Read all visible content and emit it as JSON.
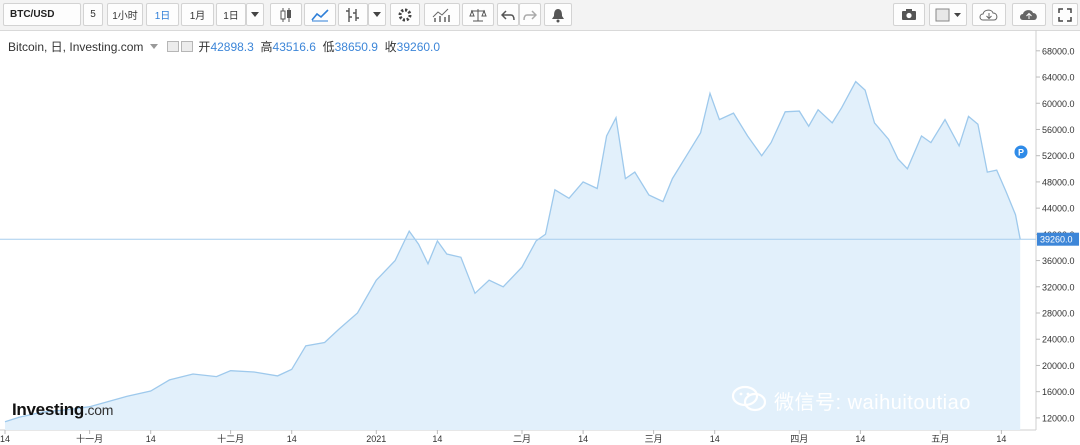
{
  "toolbar": {
    "symbol": "BTC/USD",
    "interval": "5",
    "intervals": [
      "1小时",
      "1日",
      "1月",
      "1日"
    ],
    "active_interval": "1日"
  },
  "legend": {
    "title": "Bitcoin, 日, Investing.com",
    "open_label": "开",
    "open": "42898.3",
    "high_label": "高",
    "high": "43516.6",
    "low_label": "低",
    "low": "38650.9",
    "close_label": "收",
    "close": "39260.0"
  },
  "brand": {
    "logo_main": "Investing",
    "logo_suffix": ".com"
  },
  "watermark": "微信号: waihuitoutiao",
  "marker": "P",
  "colors": {
    "line": "#9ec9ec",
    "fill": "#e2f0fb",
    "accent": "#2f7fd8",
    "price_label": "#3d86d8"
  },
  "chart_data": {
    "type": "area",
    "title": "Bitcoin, 日, Investing.com",
    "ylim": [
      10000,
      70000
    ],
    "yticks": [
      "68000.0",
      "64000.0",
      "60000.0",
      "56000.0",
      "52000.0",
      "48000.0",
      "44000.0",
      "40000.0",
      "36000.0",
      "32000.0",
      "28000.0",
      "24000.0",
      "20000.0",
      "16000.0",
      "12000.0"
    ],
    "last_price": "39260.0",
    "xticks": [
      {
        "label": "14",
        "day": 0
      },
      {
        "label": "十一月",
        "day": 18
      },
      {
        "label": "14",
        "day": 31
      },
      {
        "label": "十二月",
        "day": 48
      },
      {
        "label": "14",
        "day": 61
      },
      {
        "label": "2021",
        "day": 79
      },
      {
        "label": "14",
        "day": 92
      },
      {
        "label": "二月",
        "day": 110
      },
      {
        "label": "14",
        "day": 123
      },
      {
        "label": "三月",
        "day": 138
      },
      {
        "label": "14",
        "day": 151
      },
      {
        "label": "四月",
        "day": 169
      },
      {
        "label": "14",
        "day": 182
      },
      {
        "label": "五月",
        "day": 199
      },
      {
        "label": "14",
        "day": 212
      }
    ],
    "series": [
      {
        "points": [
          [
            0,
            11400
          ],
          [
            3,
            12100
          ],
          [
            8,
            12900
          ],
          [
            14,
            13300
          ],
          [
            18,
            13700
          ],
          [
            22,
            14500
          ],
          [
            26,
            15300
          ],
          [
            31,
            16100
          ],
          [
            35,
            17800
          ],
          [
            40,
            18700
          ],
          [
            45,
            18300
          ],
          [
            48,
            19200
          ],
          [
            53,
            19000
          ],
          [
            58,
            18400
          ],
          [
            61,
            19400
          ],
          [
            64,
            23000
          ],
          [
            68,
            23500
          ],
          [
            71,
            25500
          ],
          [
            75,
            28000
          ],
          [
            79,
            33000
          ],
          [
            83,
            36000
          ],
          [
            86,
            40500
          ],
          [
            88,
            38500
          ],
          [
            90,
            35500
          ],
          [
            92,
            39000
          ],
          [
            94,
            37000
          ],
          [
            97,
            36500
          ],
          [
            100,
            31000
          ],
          [
            103,
            33000
          ],
          [
            106,
            32000
          ],
          [
            110,
            35000
          ],
          [
            113,
            39000
          ],
          [
            115,
            40000
          ],
          [
            117,
            46800
          ],
          [
            120,
            45500
          ],
          [
            123,
            48000
          ],
          [
            126,
            47000
          ],
          [
            128,
            55000
          ],
          [
            130,
            57800
          ],
          [
            132,
            48500
          ],
          [
            134,
            49500
          ],
          [
            137,
            46000
          ],
          [
            140,
            45000
          ],
          [
            142,
            48500
          ],
          [
            145,
            52000
          ],
          [
            148,
            55500
          ],
          [
            150,
            61500
          ],
          [
            152,
            57500
          ],
          [
            155,
            58500
          ],
          [
            158,
            55000
          ],
          [
            161,
            52000
          ],
          [
            163,
            54000
          ],
          [
            166,
            58700
          ],
          [
            169,
            58800
          ],
          [
            171,
            56500
          ],
          [
            173,
            59000
          ],
          [
            176,
            57000
          ],
          [
            178,
            59300
          ],
          [
            181,
            63300
          ],
          [
            183,
            62000
          ],
          [
            185,
            57000
          ],
          [
            188,
            54500
          ],
          [
            190,
            51500
          ],
          [
            192,
            50000
          ],
          [
            195,
            55000
          ],
          [
            197,
            54000
          ],
          [
            200,
            57500
          ],
          [
            203,
            53500
          ],
          [
            205,
            58000
          ],
          [
            207,
            56800
          ],
          [
            209,
            49500
          ],
          [
            211,
            49800
          ],
          [
            213,
            46500
          ],
          [
            215,
            43000
          ],
          [
            216,
            39260
          ]
        ]
      }
    ]
  }
}
